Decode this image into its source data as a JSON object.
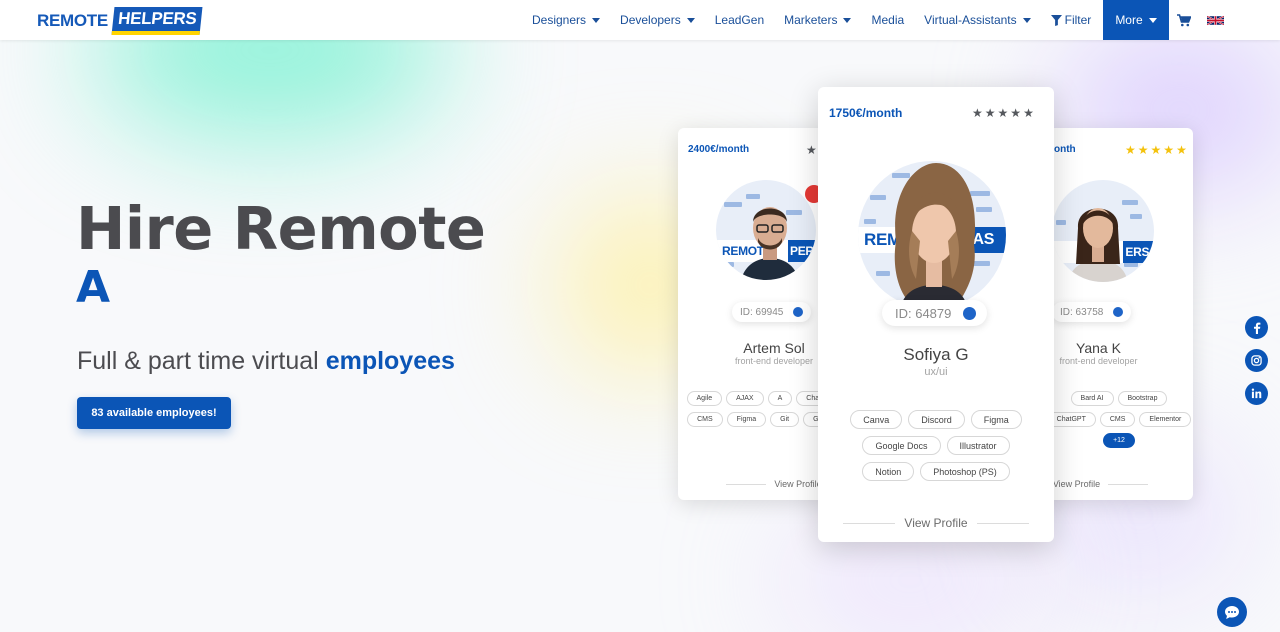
{
  "brand": {
    "part1": "REMOTE",
    "part2": "HELPERS"
  },
  "nav": {
    "items": [
      {
        "label": "Designers",
        "dropdown": true
      },
      {
        "label": "Developers",
        "dropdown": true
      },
      {
        "label": "LeadGen",
        "dropdown": false
      },
      {
        "label": "Marketers",
        "dropdown": true
      },
      {
        "label": "Media",
        "dropdown": false
      },
      {
        "label": "Virtual-Assistants",
        "dropdown": true
      }
    ],
    "filter_label": "Filter",
    "more_label": "More",
    "cart_icon": "shopping-cart-icon",
    "language_icon": "uk-flag-icon"
  },
  "hero": {
    "title": "Hire Remote",
    "typed_text": "A",
    "subtitle_prefix": "Full & part time virtual ",
    "subtitle_highlight": "employees",
    "cta_label": "83 available employees!"
  },
  "cards": {
    "left": {
      "price": "2400€/month",
      "rating": 1,
      "id_label": "ID: 69945",
      "name": "Artem Sol",
      "role": "front-end developer",
      "tags": [
        "Agile",
        "AJAX",
        "A",
        "ChatGPT",
        "CMS",
        "Figma",
        "Git",
        "GitHub"
      ],
      "view_label": "View Profile"
    },
    "main": {
      "price": "1750€/month",
      "rating": 5,
      "banner_text": "REM",
      "banner_end": "AS",
      "id_label": "ID: 64879",
      "name": "Sofiya G",
      "role": "ux/ui",
      "tags": [
        "Canva",
        "Discord",
        "Figma",
        "Google Docs",
        "Illustrator",
        "Notion",
        "Photoshop (PS)"
      ],
      "view_label": "View Profile"
    },
    "right": {
      "price": "onth",
      "rating": 5,
      "id_label": "ID: 63758",
      "name": "Yana K",
      "role": "front-end developer",
      "tags": [
        "Bard AI",
        "Bootstrap",
        "ChatGPT",
        "CMS",
        "Elementor"
      ],
      "more_tag": "+12",
      "view_label": "View Profile"
    },
    "left_banner_text": "REMOT",
    "left_banner_end": "PERS",
    "right_banner_end": "ERS"
  },
  "social": {
    "facebook": "facebook-icon",
    "instagram": "instagram-icon",
    "linkedin": "linkedin-icon",
    "chat": "chat-bubble-icon"
  },
  "colors": {
    "brand_blue": "#0b55b6",
    "text_dark": "#4b4b4f",
    "star_gold": "#f4c20d"
  }
}
